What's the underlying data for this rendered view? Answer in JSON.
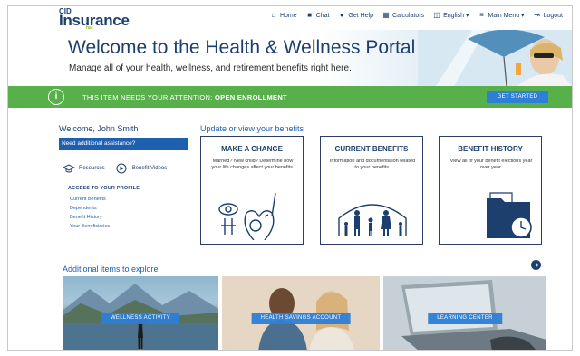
{
  "logo": {
    "top": "CID",
    "main": "Insurance",
    "sub": "hat"
  },
  "nav": [
    {
      "label": "Home",
      "icon": "home-icon"
    },
    {
      "label": "Chat",
      "icon": "chat-icon"
    },
    {
      "label": "Get Help",
      "icon": "help-icon"
    },
    {
      "label": "Calculators",
      "icon": "calculator-icon"
    },
    {
      "label": "English ▾",
      "icon": "language-icon"
    },
    {
      "label": "Main Menu ▾",
      "icon": "menu-icon"
    },
    {
      "label": "Logout",
      "icon": "logout-icon"
    }
  ],
  "hero": {
    "title": "Welcome to the Health & Wellness Portal",
    "subtitle": "Manage all of your health, wellness, and retirement benefits right here."
  },
  "alert": {
    "prefix": "THIS ITEM NEEDS YOUR ATTENTION:",
    "emphasis": "OPEN ENROLLMENT",
    "button": "GET STARTED",
    "icon_text": "i"
  },
  "sidebar": {
    "welcome": "Welcome, John Smith",
    "assist": "Need additional assistance?",
    "quick_links": [
      {
        "label": "Resources",
        "icon": "graduation-cap-icon"
      },
      {
        "label": "Benefit Videos",
        "icon": "play-icon"
      }
    ],
    "profile_heading": "ACCESS TO YOUR PROFILE",
    "profile_links": [
      "Current Benefits",
      "Dependents",
      "Benefit History",
      "Your Beneficiaries"
    ]
  },
  "update": {
    "title": "Update or view your benefits",
    "cards": [
      {
        "title": "MAKE A CHANGE",
        "desc": "Married? New child? Determine how your life changes affect your benefits."
      },
      {
        "title": "CURRENT BENEFITS",
        "desc": "Information and documentation related to your benefits."
      },
      {
        "title": "BENEFIT HISTORY",
        "desc": "View all of your benefit elections year over year."
      }
    ]
  },
  "additional": {
    "title": "Additional items to explore",
    "arrow": "➔",
    "tiles": [
      "WELLNESS ACTIVITY",
      "HEALTH SAVINGS ACCOUNT",
      "LEARNING CENTER"
    ]
  },
  "colors": {
    "brand_navy": "#1c3f6e",
    "accent_blue": "#2e7fd8",
    "alert_green": "#58b04a"
  }
}
